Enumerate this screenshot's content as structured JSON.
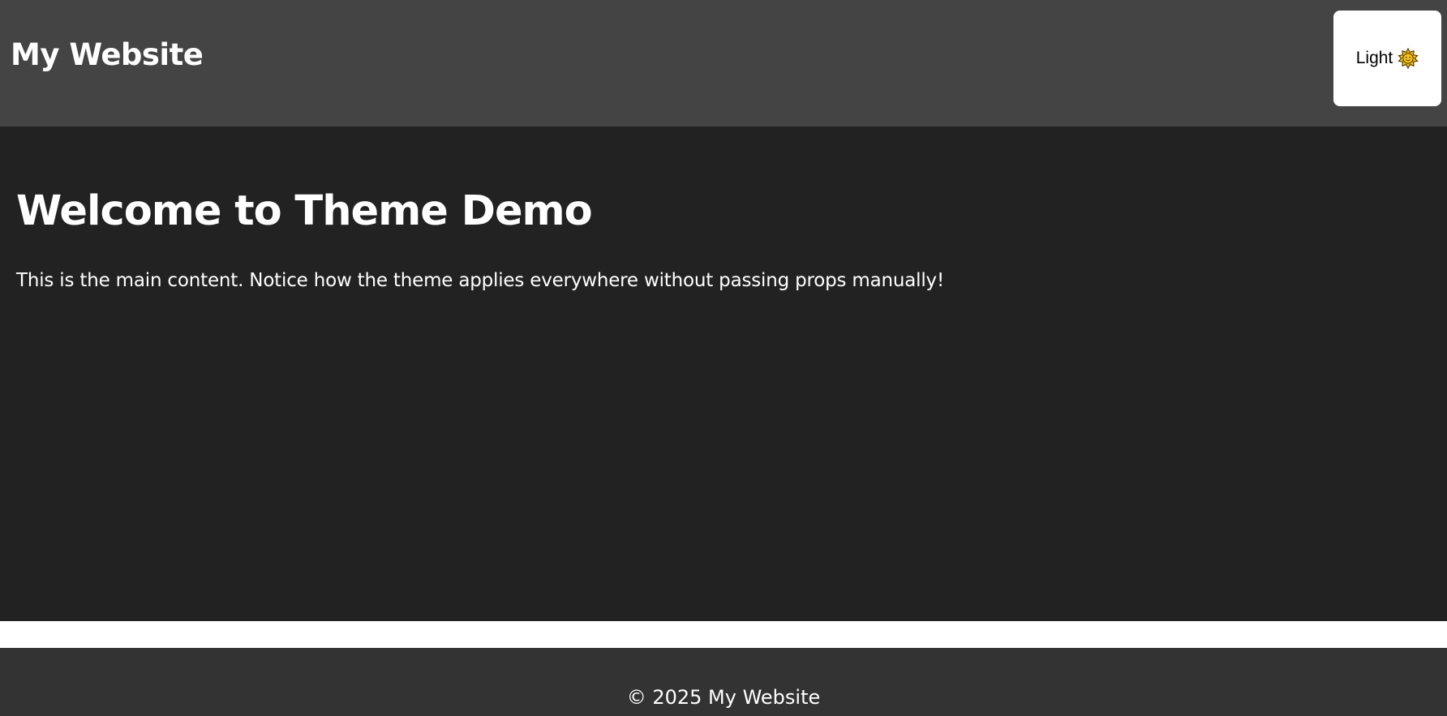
{
  "header": {
    "title": "My Website",
    "background": "#444444",
    "theme_toggle": {
      "label": "Light",
      "icon": "sun-icon"
    }
  },
  "main": {
    "background": "#222222",
    "heading": "Welcome to Theme Demo",
    "text": "This is the main content. Notice how the theme applies everywhere without passing props manually!"
  },
  "footer": {
    "background": "#333333",
    "text": "© 2025 My Website"
  },
  "colors": {
    "text": "#ffffff",
    "toggle_background": "#ffffff",
    "sun_fill": "#f5c518"
  }
}
